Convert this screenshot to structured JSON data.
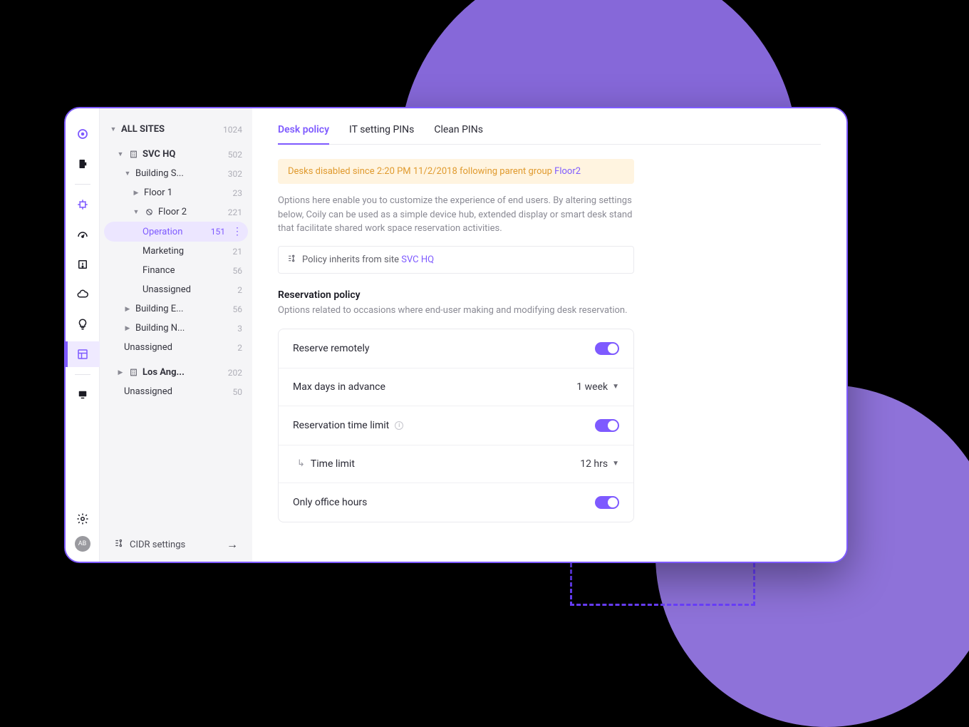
{
  "rail": {
    "avatar_initials": "AB"
  },
  "sidebar": {
    "footer_label": "CIDR settings",
    "tree": {
      "all_sites": {
        "label": "ALL SITES",
        "count": "1024"
      },
      "svc_hq": {
        "label": "SVC HQ",
        "count": "502"
      },
      "building_s": {
        "label": "Building S...",
        "count": "302"
      },
      "floor1": {
        "label": "Floor 1",
        "count": "23"
      },
      "floor2": {
        "label": "Floor 2",
        "count": "221"
      },
      "operation": {
        "label": "Operation",
        "count": "151"
      },
      "marketing": {
        "label": "Marketing",
        "count": "21"
      },
      "finance": {
        "label": "Finance",
        "count": "56"
      },
      "unassigned_f2": {
        "label": "Unassigned",
        "count": "2"
      },
      "building_e": {
        "label": "Building E...",
        "count": "56"
      },
      "building_n": {
        "label": "Building N...",
        "count": "3"
      },
      "unassigned_svc": {
        "label": "Unassigned",
        "count": "2"
      },
      "los_ang": {
        "label": "Los Ang...",
        "count": "202"
      },
      "unassigned_la": {
        "label": "Unassigned",
        "count": "50"
      }
    }
  },
  "main": {
    "tabs": {
      "desk_policy": "Desk policy",
      "it_pins": "IT setting PINs",
      "clean_pins": "Clean PINs"
    },
    "alert": {
      "text": "Desks disabled since 2:20 PM 11/2/2018 following parent group ",
      "link": "Floor2"
    },
    "description": "Options here enable you to customize the experience of end users. By altering settings below, Coily can be used as a simple device hub, extended display or smart desk stand that facilitate shared work space reservation activities.",
    "inherit": {
      "text": "Policy inherits from site ",
      "site": "SVC HQ"
    },
    "reservation": {
      "title": "Reservation policy",
      "desc": "Options related to occasions where end-user making and modifying desk reservation.",
      "reserve_remotely": "Reserve remotely",
      "max_days": {
        "label": "Max days in advance",
        "value": "1 week"
      },
      "time_limit_toggle": "Reservation time limit",
      "time_limit": {
        "label": "Time limit",
        "value": "12 hrs"
      },
      "office_hours": "Only office hours"
    }
  }
}
